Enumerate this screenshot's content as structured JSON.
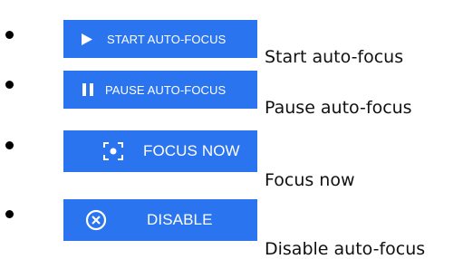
{
  "items": [
    {
      "button_label": "START AUTO-FOCUS",
      "caption": "Start auto-focus",
      "icon": "play-icon"
    },
    {
      "button_label": "PAUSE AUTO-FOCUS",
      "caption": "Pause auto-focus",
      "icon": "pause-icon"
    },
    {
      "button_label": "FOCUS NOW",
      "caption": "Focus now",
      "icon": "focus-target-icon"
    },
    {
      "button_label": "DISABLE",
      "caption": "Disable auto-focus",
      "icon": "close-circle-icon"
    }
  ],
  "colors": {
    "button_bg": "#2b74f0",
    "button_text": "#ffffff",
    "caption_text": "#111111",
    "bullet": "#000000"
  }
}
